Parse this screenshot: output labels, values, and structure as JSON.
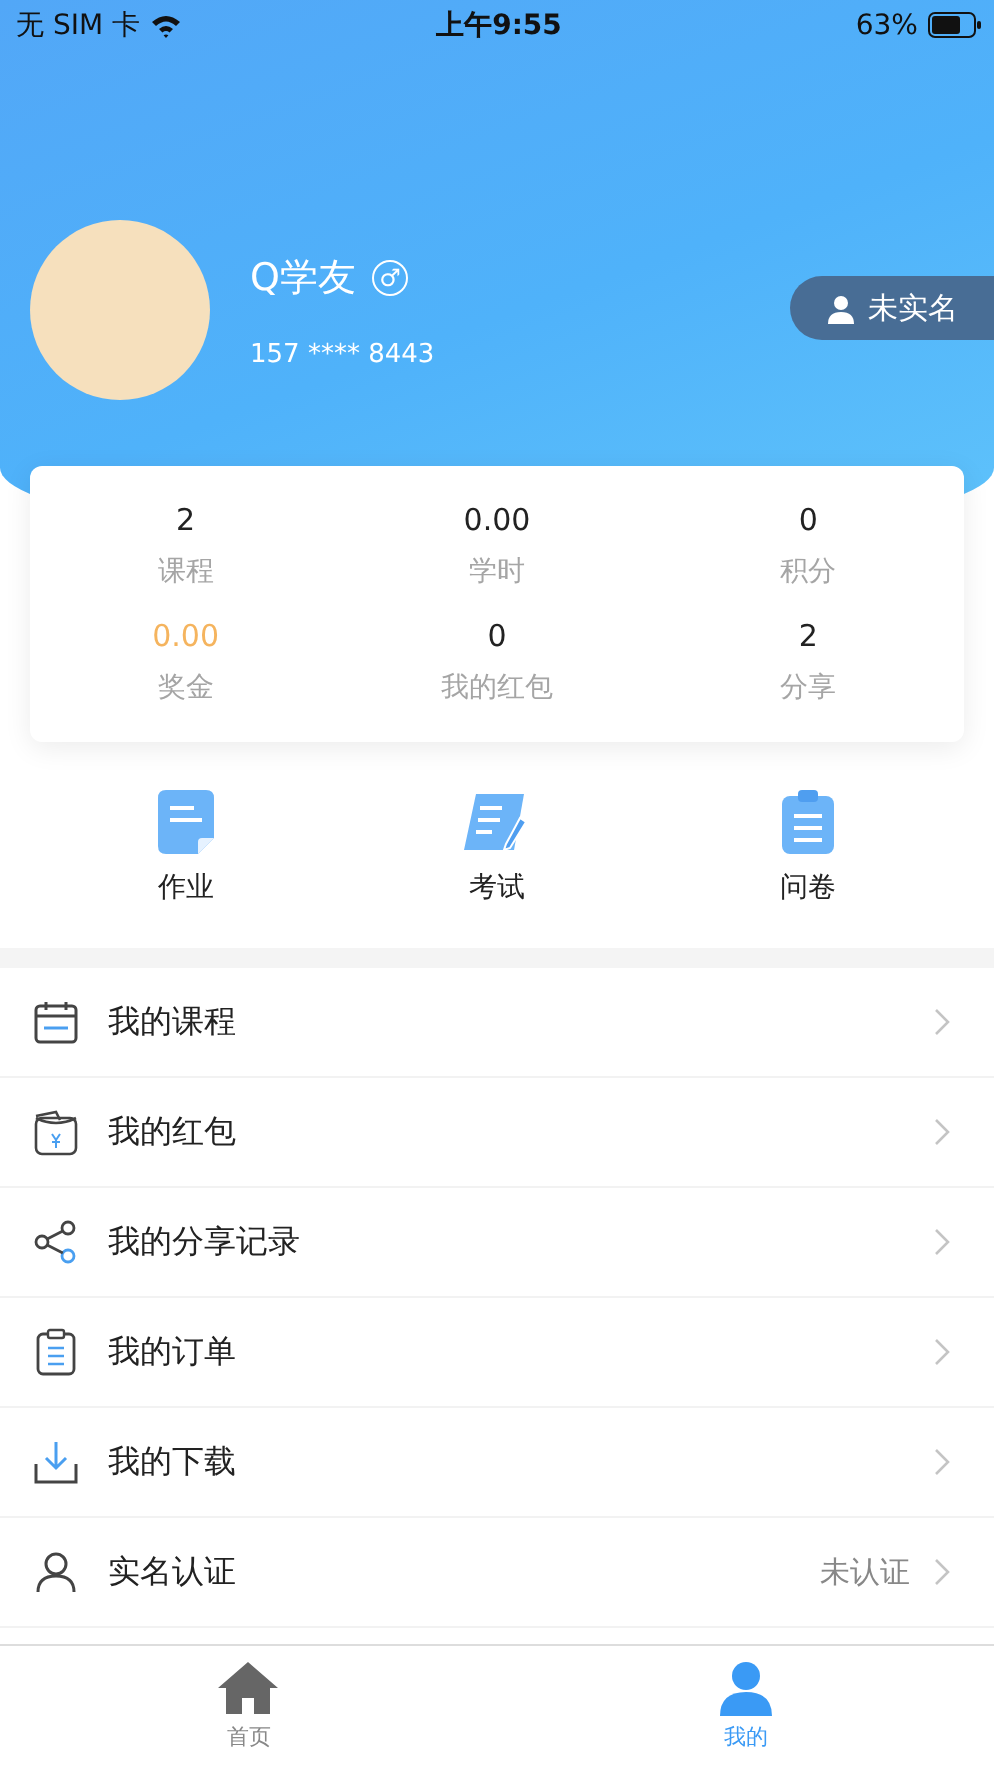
{
  "status_bar": {
    "carrier": "无 SIM 卡",
    "time": "上午9:55",
    "battery": "63%"
  },
  "profile": {
    "name": "Q学友",
    "gender_symbol": "♂",
    "phone": "157 **** 8443",
    "verify_badge": "未实名"
  },
  "stats": [
    {
      "value": "2",
      "label": "课程",
      "color": "#222222"
    },
    {
      "value": "0.00",
      "label": "学时",
      "color": "#222222"
    },
    {
      "value": "0",
      "label": "积分",
      "color": "#222222"
    },
    {
      "value": "0.00",
      "label": "奖金",
      "color": "#f5b45e"
    },
    {
      "value": "0",
      "label": "我的红包",
      "color": "#222222"
    },
    {
      "value": "2",
      "label": "分享",
      "color": "#222222"
    }
  ],
  "quick_actions": [
    {
      "label": "作业",
      "kind": "document"
    },
    {
      "label": "考试",
      "kind": "scroll"
    },
    {
      "label": "问卷",
      "kind": "clipboard"
    }
  ],
  "menu": [
    {
      "label": "我的课程",
      "kind": "calendar"
    },
    {
      "label": "我的红包",
      "kind": "wallet"
    },
    {
      "label": "我的分享记录",
      "kind": "share"
    },
    {
      "label": "我的订单",
      "kind": "clipboard"
    },
    {
      "label": "我的下载",
      "kind": "download"
    },
    {
      "label": "实名认证",
      "kind": "person",
      "value": "未认证"
    }
  ],
  "tab_bar": [
    {
      "label": "首页",
      "kind": "home",
      "selected": false
    },
    {
      "label": "我的",
      "kind": "person",
      "selected": true
    }
  ]
}
